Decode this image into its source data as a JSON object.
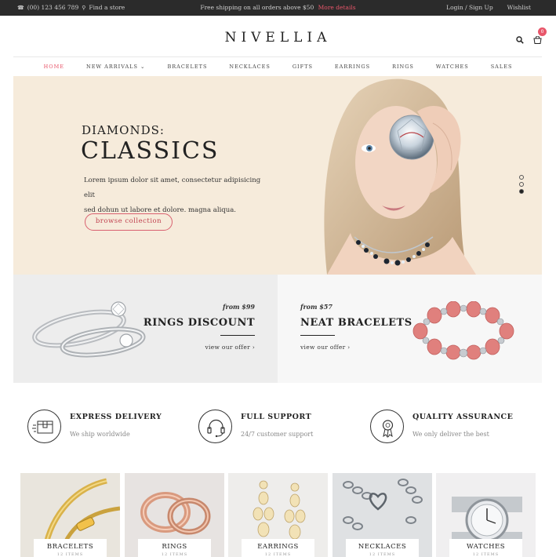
{
  "topbar": {
    "phone": "(00) 123 456 789",
    "store": "Find a store",
    "shipping": "Free shipping on all orders above $50",
    "more_details": "More details",
    "login": "Login / Sign Up",
    "wishlist": "Wishlist"
  },
  "header": {
    "logo": "NIVELLIA",
    "cart_count": "0"
  },
  "nav": {
    "items": [
      "HOME",
      "NEW ARRIVALS",
      "BRACELETS",
      "NECKLACES",
      "GIFTS",
      "EARRINGS",
      "RINGS",
      "WATCHES",
      "SALES"
    ],
    "active": "HOME",
    "accent": "#e8566a"
  },
  "hero": {
    "kicker": "DIAMONDS:",
    "title": "CLASSICS",
    "text_line1": "Lorem ipsum dolor sit amet, consectetur adipisicing elit",
    "text_line2": "sed dohun ut labore et dolore. magna aliqua.",
    "button": "browse collection",
    "background": "#f6ebdb"
  },
  "promos": {
    "rings": {
      "from": "from $99",
      "title": "RINGS DISCOUNT",
      "offer": "view our offer"
    },
    "bracelets": {
      "from": "from $57",
      "title": "NEAT BRACELETS",
      "offer": "view our offer"
    }
  },
  "features": [
    {
      "icon": "delivery-box-icon",
      "title": "EXPRESS DELIVERY",
      "subtitle": "We ship worldwide"
    },
    {
      "icon": "headset-icon",
      "title": "FULL SUPPORT",
      "subtitle": "24/7 customer support"
    },
    {
      "icon": "medal-icon",
      "title": "QUALITY ASSURANCE",
      "subtitle": "We only deliver the best"
    }
  ],
  "categories": [
    {
      "name": "BRACELETS",
      "count": "12 ITEMS"
    },
    {
      "name": "RINGS",
      "count": "12 ITEMS"
    },
    {
      "name": "EARRINGS",
      "count": "12 ITEMS"
    },
    {
      "name": "NECKLACES",
      "count": "12 ITEMS"
    },
    {
      "name": "WATCHES",
      "count": "12 ITEMS"
    }
  ]
}
